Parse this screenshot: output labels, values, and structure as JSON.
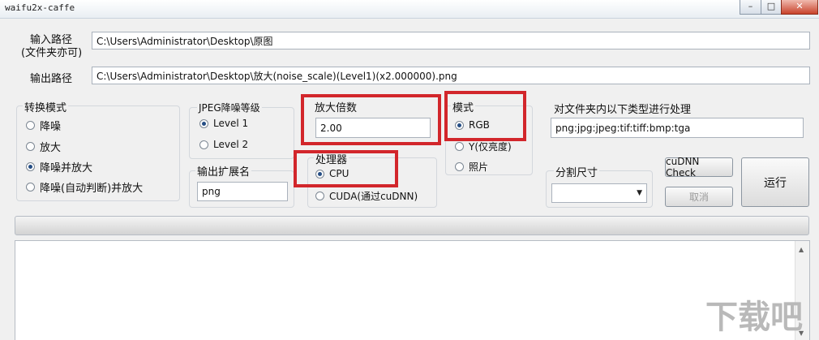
{
  "window": {
    "title": "waifu2x-caffe",
    "minimize_glyph": "–",
    "maximize_glyph": "□",
    "close_glyph": "✕"
  },
  "input_path": {
    "label_line1": "输入路径",
    "label_line2": "(文件夹亦可)",
    "value": "C:\\Users\\Administrator\\Desktop\\原图"
  },
  "output_path": {
    "label": "输出路径",
    "value": "C:\\Users\\Administrator\\Desktop\\放大(noise_scale)(Level1)(x2.000000).png"
  },
  "conversion_mode": {
    "title": "转换模式",
    "options": [
      "降噪",
      "放大",
      "降噪并放大",
      "降噪(自动判断)并放大"
    ],
    "selected": "降噪并放大"
  },
  "jpeg_noise": {
    "title": "JPEG降噪等级",
    "options": [
      "Level 1",
      "Level 2"
    ],
    "selected": "Level 1"
  },
  "output_ext": {
    "title": "输出扩展名",
    "value": "png"
  },
  "scale": {
    "title": "放大倍数",
    "value": "2.00"
  },
  "processor": {
    "title": "处理器",
    "options": [
      "CPU",
      "CUDA(通过cuDNN)"
    ],
    "selected": "CPU"
  },
  "model": {
    "title": "模式",
    "options": [
      "RGB",
      "Y(仅亮度)",
      "照片"
    ],
    "selected": "RGB"
  },
  "file_types": {
    "title": "对文件夹内以下类型进行处理",
    "value": "png:jpg:jpeg:tif:tiff:bmp:tga"
  },
  "split_size": {
    "title": "分割尺寸",
    "value": "",
    "dropdown_glyph": "▼"
  },
  "buttons": {
    "cudnn_check": "cuDNN Check",
    "cancel": "取消",
    "run": "运行"
  },
  "progress": {
    "value": 0
  },
  "log": {
    "text": ""
  },
  "watermark": {
    "text": "下载吧"
  },
  "colors": {
    "highlight_box": "#d2262b",
    "radio_dot": "#244d84"
  }
}
